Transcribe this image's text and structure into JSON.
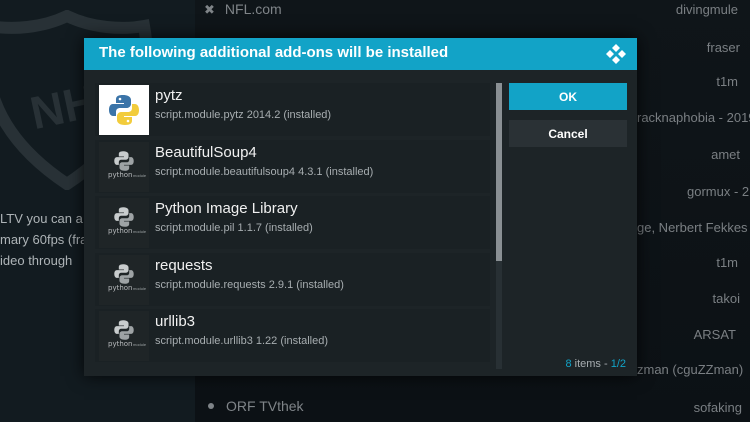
{
  "background": {
    "top_item": "NFL.com",
    "bottom_item": "ORF TVthek",
    "description_lines": [
      "LTV you can a",
      "mary 60fps (fra",
      "ideo through"
    ],
    "right_labels": [
      "divingmule",
      "fraser",
      "t1m",
      "racknaphobia - 2019",
      "amet",
      "gormux - 2",
      "ge, Nerbert Fekkes",
      "t1m",
      "takoi",
      "ARSAT",
      "zman (cguZZman)",
      "sofaking"
    ]
  },
  "dialog": {
    "title": "The following additional add-ons will be installed",
    "ok_label": "OK",
    "cancel_label": "Cancel",
    "pager": {
      "count": "8",
      "items_label": "items",
      "separator": "-",
      "page": "1/2"
    },
    "addons": [
      {
        "name": "pytz",
        "desc": "script.module.pytz 2014.2 (installed)",
        "icon": "python-logo-icon"
      },
      {
        "name": "BeautifulSoup4",
        "desc": "script.module.beautifulsoup4 4.3.1 (installed)",
        "icon": "python-module-icon"
      },
      {
        "name": "Python Image Library",
        "desc": "script.module.pil 1.1.7 (installed)",
        "icon": "python-module-icon"
      },
      {
        "name": "requests",
        "desc": "script.module.requests 2.9.1 (installed)",
        "icon": "python-module-icon"
      },
      {
        "name": "urllib3",
        "desc": "script.module.urllib3 1.22 (installed)",
        "icon": "python-module-icon"
      }
    ],
    "thumb_text": "python",
    "thumb_subtext": "module"
  },
  "colors": {
    "accent": "#12a3c7",
    "dialog_bg": "#1d2427",
    "python_blue": "#3b74a8",
    "python_yellow": "#f2cc3c"
  }
}
